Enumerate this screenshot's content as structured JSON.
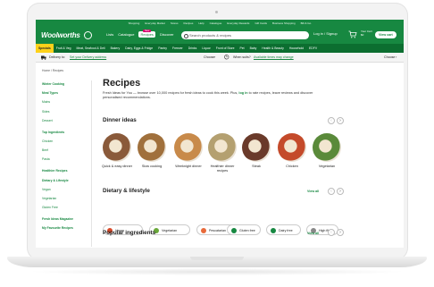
{
  "utility_links": [
    "Shopping",
    "Everyday Market",
    "Stores",
    "Recipes",
    "Help",
    "Catalogue",
    "Everyday Rewards",
    "Gift Cards",
    "Business Shopping",
    "Bill & Go"
  ],
  "header": {
    "logo": "Woolworths",
    "links": [
      "Lists",
      "Catalogue",
      "Recipes",
      "Discover"
    ],
    "new_badge": "New",
    "search_placeholder": "Search products & recipes",
    "login": "Log in / Signup",
    "cart_line1": "Your Cart",
    "cart_line2": "$0",
    "view_cart": "View cart"
  },
  "categories": [
    "Specials",
    "Fruit & Veg",
    "Meat, Seafood & Deli",
    "Bakery",
    "Dairy, Eggs & Fridge",
    "Pantry",
    "Freezer",
    "Drinks",
    "Liquor",
    "Front of Store",
    "Pet",
    "Baby",
    "Health & Beauty",
    "Household",
    "EDFV"
  ],
  "delivery": {
    "delivery_to": "Delivery to:",
    "address_link": "Set your Delivery address",
    "choose1": "Choose",
    "when": "When suits?",
    "time_link": "Available times may change",
    "choose2": "Choose"
  },
  "breadcrumb": "Home  /  Recipes",
  "sidebar": [
    {
      "label": "Winter Cooking",
      "kind": "head"
    },
    {
      "label": "Meal Types",
      "kind": "head"
    },
    {
      "label": "Mains",
      "kind": "sub"
    },
    {
      "label": "Sides",
      "kind": "sub"
    },
    {
      "label": "Dessert",
      "kind": "sub"
    },
    {
      "label": "Top Ingredients",
      "kind": "head"
    },
    {
      "label": "Chicken",
      "kind": "sub"
    },
    {
      "label": "Beef",
      "kind": "sub"
    },
    {
      "label": "Pasta",
      "kind": "sub"
    },
    {
      "label": "Healthier Recipes",
      "kind": "head"
    },
    {
      "label": "Dietary & Lifestyle",
      "kind": "head"
    },
    {
      "label": "Vegan",
      "kind": "sub"
    },
    {
      "label": "Vegetarian",
      "kind": "sub"
    },
    {
      "label": "Gluten Free",
      "kind": "sub"
    },
    {
      "label": "Fresh Ideas Magazine",
      "kind": "head"
    },
    {
      "label": "My Favourite Recipes",
      "kind": "head"
    }
  ],
  "main": {
    "title": "Recipes",
    "intro_a": "Fresh Ideas for You — browse over 10,000 recipes for fresh ideas to cook this week. Plus,",
    "intro_link": "log in",
    "intro_b": "to rate recipes, leave reviews and discover personalised recommendations.",
    "dinner_title": "Dinner ideas",
    "dinner_items": [
      {
        "label": "Quick & easy dinner",
        "color": "#8a5a3a"
      },
      {
        "label": "Slow cooking",
        "color": "#a0703c"
      },
      {
        "label": "Weeknight dinner",
        "color": "#c88a4a"
      },
      {
        "label": "Healthier dinner recipes",
        "color": "#b4a070"
      },
      {
        "label": "Steak",
        "color": "#6a3a2a"
      },
      {
        "label": "Chicken",
        "color": "#c44a2a"
      },
      {
        "label": "Vegetarian",
        "color": "#5a8a3a"
      }
    ],
    "dietary_title": "Dietary & lifestyle",
    "view_all": "View all",
    "dietary_items": [
      {
        "label": "Vegan",
        "color": "#d84a2a"
      },
      {
        "label": "Vegetarian",
        "color": "#6aa83a"
      },
      {
        "label": "Pescatarian",
        "color": "#e86a3a"
      },
      {
        "label": "Gluten free",
        "color": "#178841"
      },
      {
        "label": "Dairy free",
        "color": "#178841"
      },
      {
        "label": "High fibre",
        "color": "#888888"
      }
    ],
    "popular_title": "Popular ingredients"
  },
  "colors": {
    "brand_green": "#178841",
    "dark_green": "#0c6e30",
    "specials_yellow": "#fdd11a"
  }
}
